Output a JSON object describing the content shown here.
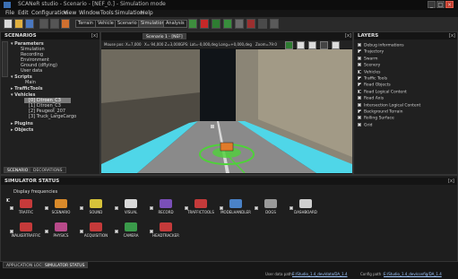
{
  "window": {
    "title": "SCANeR studio - Scenario - [NEF_0.] - Simulation mode"
  },
  "menu": [
    "File",
    "Edit",
    "Configuration",
    "View",
    "Window",
    "Tools",
    "Simulation",
    "Help"
  ],
  "toolbar": {
    "modes": [
      "Terrain",
      "Vehicle",
      "Scenario",
      "Simulation",
      "Analysis"
    ]
  },
  "scenarios_panel": {
    "title": "SCENARIOS",
    "side_tab": "Scenario",
    "tree": [
      "Parameters",
      "Simulation",
      "Recording",
      "Environment",
      "Ground (dflying)",
      "User data",
      "Scripts",
      "Main",
      "TrafficTools",
      "Vehicles",
      "[0] Citroen_C3",
      "[1] Citroen_C3",
      "[2] Peugeot_207",
      "[3] Truck_LargeCargo",
      "Plugins",
      "Objects"
    ],
    "tabs": [
      "SCENARIO",
      "DECORATIONS"
    ]
  },
  "viewport": {
    "tab": "Scenario 1 - [NEF]",
    "info_left": "Mouse pos: X=7,000",
    "info_pos": "X= 94,000  Z=3,000",
    "info_gps": "GPS:  Lat=-0,000,deg  Long=+0,000,deg",
    "info_zoom": "Zoom=79:0"
  },
  "layers_panel": {
    "title": "LAYERS",
    "items": [
      {
        "label": "Debug informations",
        "checked": false
      },
      {
        "label": "Trajectory",
        "checked": true
      },
      {
        "label": "Swarm",
        "checked": false
      },
      {
        "label": "Scenery",
        "checked": false
      },
      {
        "label": "Vehicles",
        "checked": true
      },
      {
        "label": "Traffic Tools",
        "checked": true
      },
      {
        "label": "Road Objects",
        "checked": true
      },
      {
        "label": "Road Logical Content",
        "checked": true
      },
      {
        "label": "Road Axis",
        "checked": false
      },
      {
        "label": "Intersection Logical Content",
        "checked": false
      },
      {
        "label": "Background Terrain",
        "checked": true
      },
      {
        "label": "Rolling Surface",
        "checked": false
      },
      {
        "label": "Grid",
        "checked": false
      }
    ]
  },
  "simulator_status": {
    "title": "SIMULATOR STATUS",
    "display_frequencies": "Display frequencies",
    "row1": [
      "TRAFFIC",
      "SCENARIO",
      "SOUND",
      "VISUAL",
      "RECORD",
      "TRAFFICTOOLS",
      "MODELHANDLER",
      "DOGS",
      "DASHBOARD"
    ],
    "row2": [
      "WALKERTRAFFIC",
      "PHYSICS",
      "ACQUISITION",
      "CAMERA",
      "HEADTRACKER"
    ],
    "tabs": [
      "APPLICATION LOG",
      "SIMULATOR STATUS"
    ],
    "user_data_path_label": "User data path :",
    "user_data_path": "E:/Studio_1.4_dev/data/DA_1.4",
    "config_path_label": "Config path :",
    "config_path": "E:/Studio_1.4_dev/config/DA_1.4"
  },
  "colors": {
    "accent_cyan": "#4fd6e8",
    "selection": "#7a7a7a",
    "close_red": "#c03a2b",
    "green_target": "#4fd13a"
  }
}
